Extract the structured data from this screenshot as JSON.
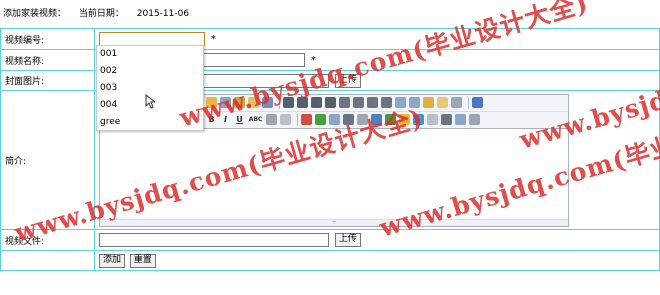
{
  "header": {
    "title": "添加家装视频：",
    "date_label": "当前日期：",
    "date_value": "2015-11-06"
  },
  "form": {
    "video_no": {
      "label": "视频编号:",
      "value": "",
      "required_mark": "*"
    },
    "video_name": {
      "label": "视频名称:",
      "value": "",
      "required_mark": "*"
    },
    "cover_image": {
      "label": "封面图片:",
      "value": "",
      "upload_button": "上传"
    },
    "intro": {
      "label": "简介:"
    },
    "video_file": {
      "label": "视频文件:",
      "value": "",
      "upload_button": "上传"
    },
    "actions": {
      "add_button": "添加",
      "reset_button": "重置"
    }
  },
  "autocomplete": {
    "options": [
      "001",
      "002",
      "003",
      "004",
      "gree"
    ]
  },
  "editor": {
    "toolbar_row1": [
      "new-doc",
      "cut",
      "copy",
      "paste",
      "paste-text",
      "paste-word",
      "align-left",
      "align-center",
      "align-right",
      "align-justify",
      "ordered-list",
      "unordered-list",
      "indent",
      "outdent",
      "subscript",
      "superscript",
      "clear-format",
      "select-all",
      "preview",
      "help"
    ],
    "toolbar_row2_text": {
      "bold": "B",
      "italic": "I",
      "underline": "U",
      "abc": "ABC"
    },
    "resize_glyph": "÷"
  },
  "watermark": {
    "lines": [
      "www.bysjdq.com(毕业设计大全)",
      "www.bysjdq.com(毕业设计大全)",
      "www.bysjdq.com(毕业设计大全)",
      "www.bysjdq.com(毕业设计大全)"
    ],
    "color": "#dc2d2d"
  }
}
